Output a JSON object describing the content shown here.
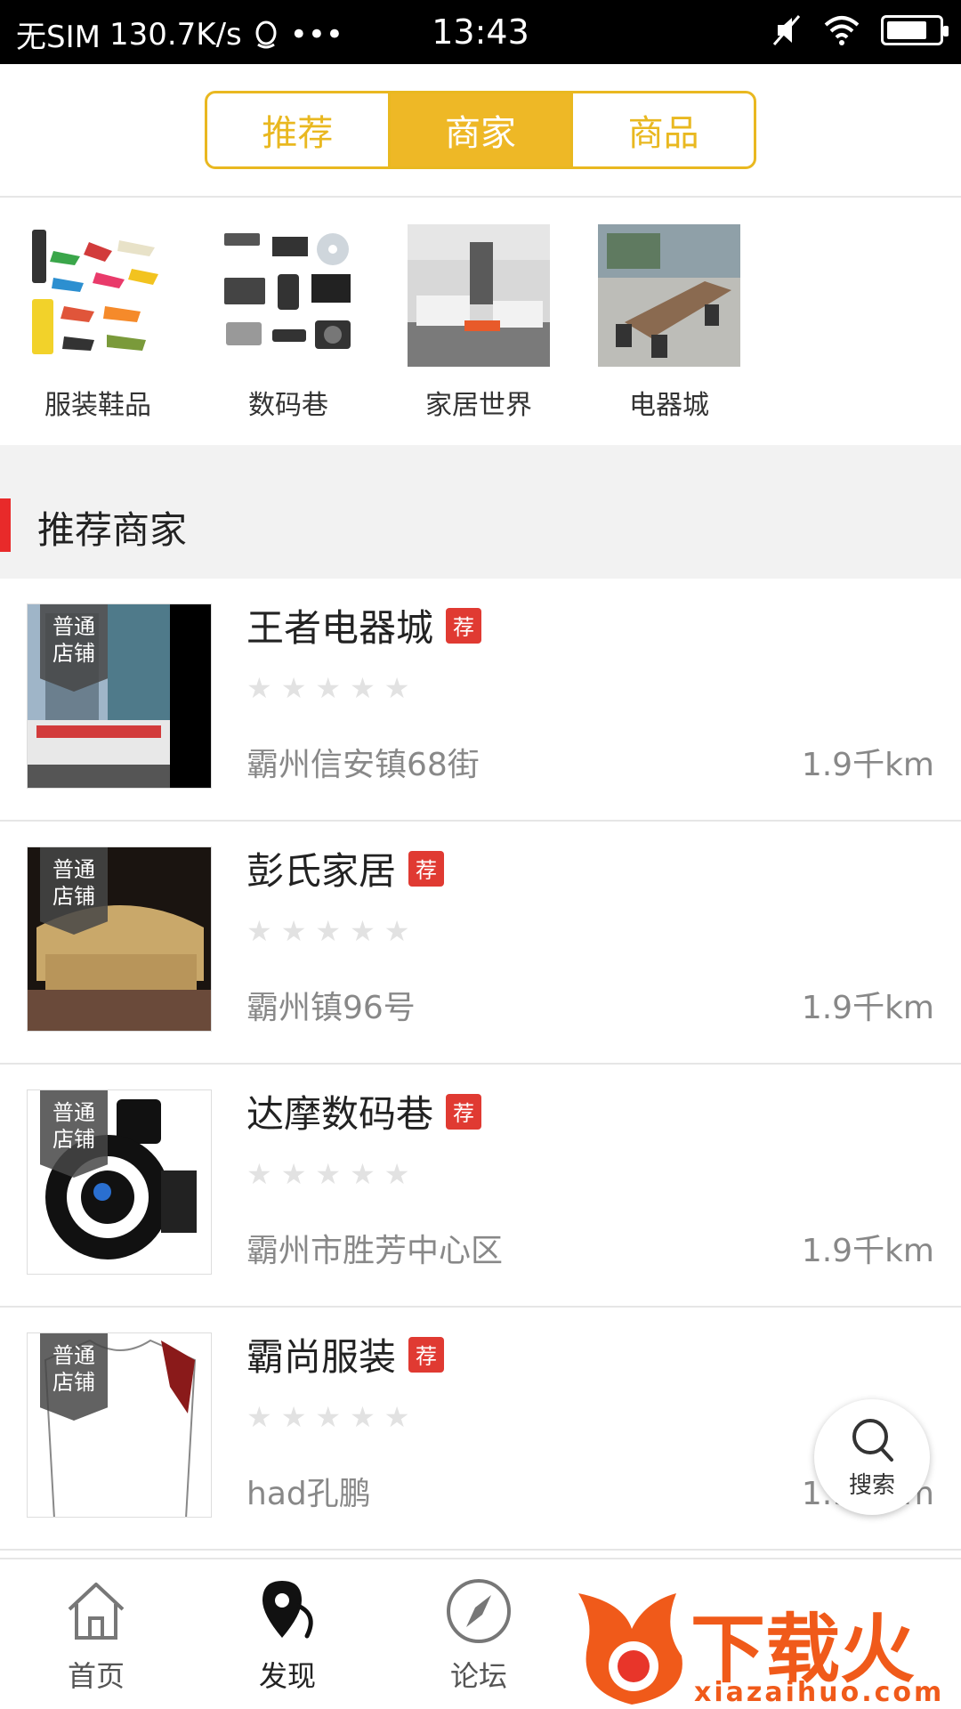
{
  "status_bar": {
    "carrier": "无SIM",
    "speed": "130.7K/s",
    "more": "•••",
    "time": "13:43"
  },
  "tabs": [
    {
      "label": "推荐",
      "active": false
    },
    {
      "label": "商家",
      "active": true
    },
    {
      "label": "商品",
      "active": false
    }
  ],
  "categories": [
    {
      "label": "服装鞋品",
      "icon": "shoes-image"
    },
    {
      "label": "数码巷",
      "icon": "electronics-image"
    },
    {
      "label": "家居世界",
      "icon": "living-room-image"
    },
    {
      "label": "电器城",
      "icon": "conference-room-image"
    }
  ],
  "section": {
    "title": "推荐商家"
  },
  "merchants": [
    {
      "name": "王者电器城",
      "badge": "普通\n店铺",
      "rec": "荐",
      "rating": 0,
      "address": "霸州信安镇68街",
      "distance": "1.9千km"
    },
    {
      "name": "彭氏家居",
      "badge": "普通\n店铺",
      "rec": "荐",
      "rating": 0,
      "address": "霸州镇96号",
      "distance": "1.9千km"
    },
    {
      "name": "达摩数码巷",
      "badge": "普通\n店铺",
      "rec": "荐",
      "rating": 0,
      "address": "霸州市胜芳中心区",
      "distance": "1.9千km"
    },
    {
      "name": "霸尚服装",
      "badge": "普通\n店铺",
      "rec": "荐",
      "rating": 0,
      "address": "had孔鹏",
      "distance": "1.9千km"
    }
  ],
  "fab": {
    "label": "搜索"
  },
  "bottom_nav": [
    {
      "label": "首页",
      "icon": "home-icon"
    },
    {
      "label": "发现",
      "icon": "discover-icon"
    },
    {
      "label": "论坛",
      "icon": "compass-icon"
    }
  ],
  "watermark": {
    "text": "下载火",
    "url": "xiazaihuo.com"
  },
  "colors": {
    "accent": "#eeb826",
    "rec_badge": "#e03a32",
    "section_bar": "#e82a2a",
    "watermark": "#f05a1a"
  }
}
